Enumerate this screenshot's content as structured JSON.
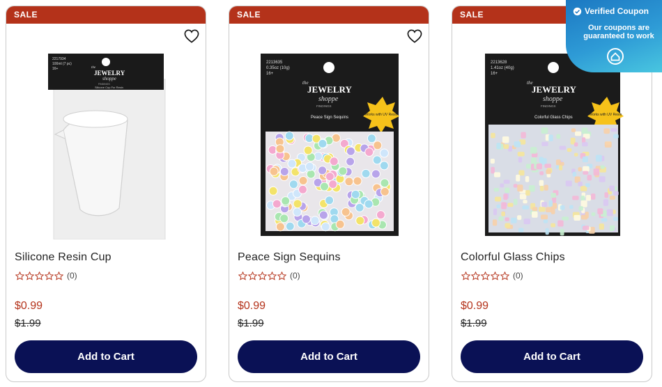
{
  "products": [
    {
      "badge": "SALE",
      "name": "Silicone Resin Cup",
      "rating": 0,
      "rating_count": "(0)",
      "price": "$0.99",
      "was_price": "$1.99",
      "cta": "Add to Cart",
      "image_icon": "resin-cup-bag-image",
      "package": {
        "sku": "2217934",
        "size": "100ml (7 pc)",
        "age": "16+",
        "label": "Silicone Cup For Resin"
      }
    },
    {
      "badge": "SALE",
      "name": "Peace Sign Sequins",
      "rating": 0,
      "rating_count": "(0)",
      "price": "$0.99",
      "was_price": "$1.99",
      "cta": "Add to Cart",
      "image_icon": "peace-sequins-bag-image",
      "package": {
        "sku": "2213635",
        "size": "0.35oz (10g)",
        "age": "16+",
        "label": "Peace Sign Sequins",
        "burst": "Works with UV Resin"
      }
    },
    {
      "badge": "SALE",
      "name": "Colorful Glass Chips",
      "rating": 0,
      "rating_count": "(0)",
      "price": "$0.99",
      "was_price": "$1.99",
      "cta": "Add to Cart",
      "image_icon": "glass-chips-bag-image",
      "package": {
        "sku": "2213628",
        "size": "1.41oz (40g)",
        "age": "16+",
        "label": "Colorful Glass Chips",
        "burst": "Works with UV Resin"
      }
    }
  ],
  "brand": {
    "top": "the",
    "main": "JEWELRY",
    "sub": "shoppe",
    "tag": "FINDINGS"
  },
  "coupon": {
    "title": "Verified Coupon",
    "description": "Our coupons are guaranteed to work"
  },
  "colors": {
    "sale_band": "#b4321a",
    "price": "#b4321a",
    "cta_bg": "#0a1155",
    "coupon_bg": "#2e9bd6"
  }
}
